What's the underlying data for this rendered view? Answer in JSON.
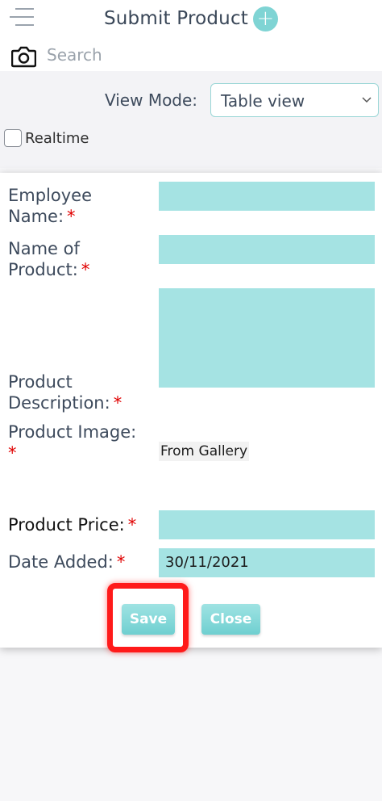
{
  "header": {
    "title": "Submit Product",
    "add_icon": "plus-icon",
    "menu_icon": "menu-icon",
    "camera_icon": "camera-icon",
    "search_placeholder": "Search"
  },
  "toolbar": {
    "view_mode_label": "View Mode:",
    "view_mode_value": "Table view",
    "realtime_label": "Realtime",
    "realtime_checked": false
  },
  "form": {
    "employee_name": {
      "label_line1": "Employee",
      "label_line2": "Name:",
      "required": "*",
      "value": ""
    },
    "product_name": {
      "label_line1": "Name of",
      "label_line2": "Product:",
      "required": "*",
      "value": ""
    },
    "description": {
      "label_line1": "Product",
      "label_line2": "Description:",
      "required": "*",
      "value": ""
    },
    "image": {
      "label": "Product Image:",
      "required": "*",
      "button": "From Gallery"
    },
    "price": {
      "label": "Product Price:",
      "required": "*",
      "value": ""
    },
    "date": {
      "label": "Date Added:",
      "required": "*",
      "value": "30/11/2021"
    }
  },
  "actions": {
    "save": "Save",
    "close": "Close"
  },
  "colors": {
    "accent": "#7fd4d4",
    "input_bg": "#a5e3e3",
    "required": "#e00000",
    "highlight": "#ff1a1a"
  }
}
